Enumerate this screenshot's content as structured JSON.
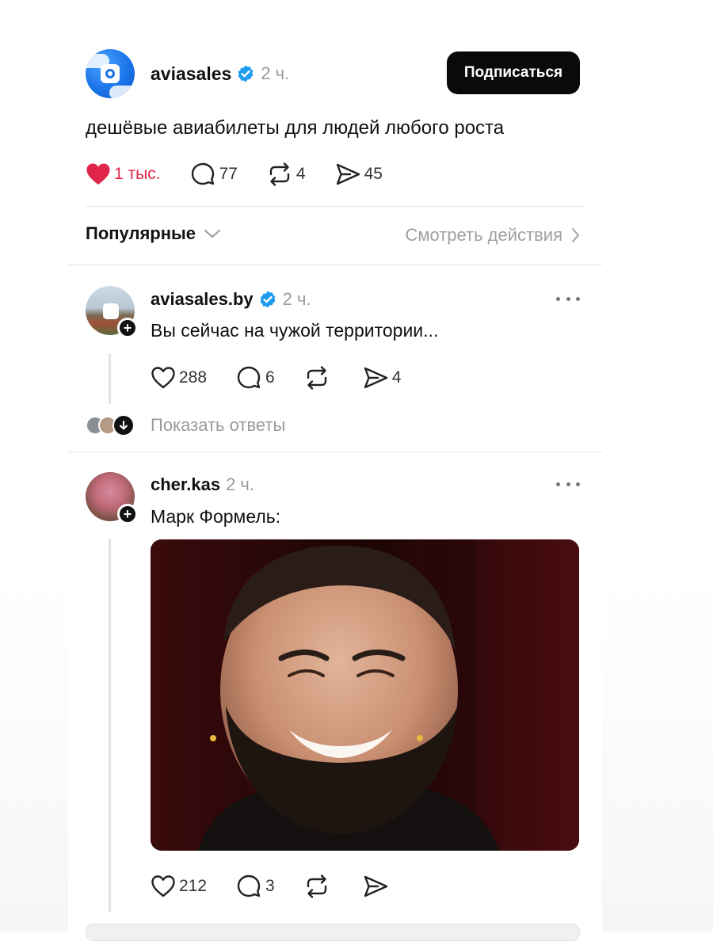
{
  "main_post": {
    "username": "aviasales",
    "time": "2 ч.",
    "follow_label": "Подписаться",
    "text": "дешёвые авиабилеты для людей любого роста",
    "likes": "1 тыс.",
    "comments": "77",
    "reposts": "4",
    "shares": "45"
  },
  "sort_bar": {
    "sort_label": "Популярные",
    "view_activity": "Смотреть действия"
  },
  "replies": [
    {
      "username": "aviasales.by",
      "time": "2 ч.",
      "text": "Вы сейчас на чужой территории...",
      "likes": "288",
      "comments": "6",
      "reposts": "",
      "shares": "4",
      "show_replies": "Показать ответы"
    },
    {
      "username": "cher.kas",
      "time": "2 ч.",
      "text": "Марк Формель:",
      "likes": "212",
      "comments": "3",
      "reposts": "",
      "shares": ""
    }
  ],
  "colors": {
    "like_red": "#e0244a",
    "verified_blue": "#1d9bf0",
    "muted_text": "#9a9a9a",
    "button_black": "#0a0a0a"
  },
  "icons": [
    "heart-icon",
    "comment-icon",
    "repost-icon",
    "share-icon",
    "verified-icon",
    "chevron-down-icon",
    "chevron-right-icon",
    "more-icon",
    "plus-icon",
    "arrow-down-icon"
  ]
}
